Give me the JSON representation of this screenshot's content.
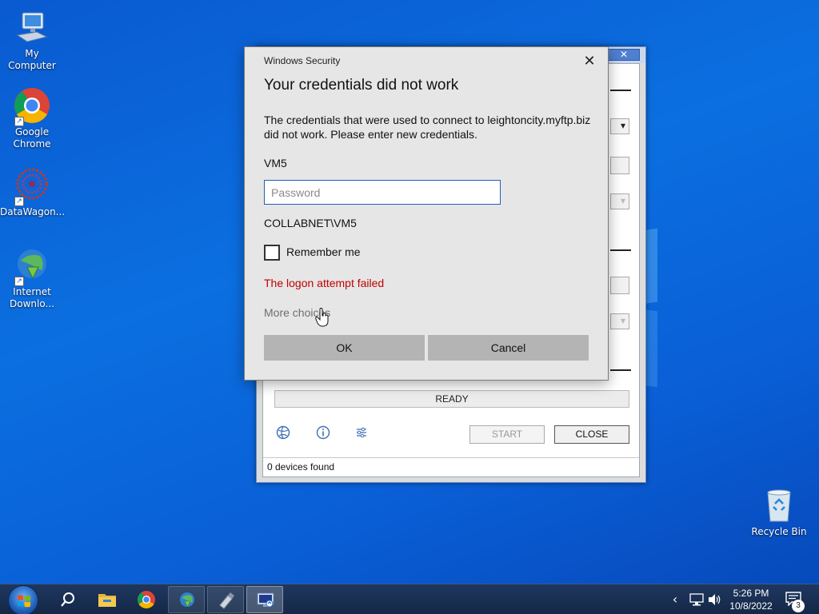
{
  "desktop": {
    "icons": [
      {
        "label": "My Computer"
      },
      {
        "label": "Google Chrome"
      },
      {
        "label": "DataWagon..."
      },
      {
        "label": "Internet Downlo..."
      },
      {
        "label": "Recycle Bin"
      }
    ]
  },
  "background_window": {
    "close_glyph": "✕",
    "ready_text": "READY",
    "start_label": "START",
    "close_label": "CLOSE",
    "status_text": "0 devices found",
    "tool_icons": [
      "globe-icon",
      "info-icon",
      "settings-sliders-icon"
    ]
  },
  "dialog": {
    "caption": "Windows Security",
    "close_glyph": "✕",
    "heading": "Your credentials did not work",
    "message": "The credentials that were used to connect to leightoncity.myftp.biz did not work. Please enter new credentials.",
    "username": "VM5",
    "password_placeholder": "Password",
    "password_value": "",
    "domain_user": "COLLABNET\\VM5",
    "remember_label": "Remember me",
    "remember_checked": false,
    "error_text": "The logon attempt failed",
    "more_choices": "More choices",
    "ok_label": "OK",
    "cancel_label": "Cancel"
  },
  "taskbar": {
    "pinned": [
      "search-icon",
      "file-explorer-icon",
      "chrome-icon",
      "internet-download-manager-icon",
      "usb-drive-icon",
      "remote-desktop-icon"
    ],
    "tray": {
      "chevron": "‹",
      "clock_time": "5:26 PM",
      "clock_date": "10/8/2022",
      "notification_count": "3"
    }
  },
  "colors": {
    "error": "#c00000",
    "accent": "#1f5fbf",
    "desktop_bg": "#0b6fe0"
  }
}
